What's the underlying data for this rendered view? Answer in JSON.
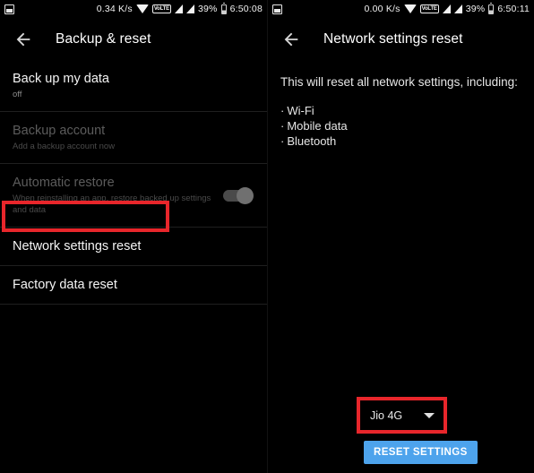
{
  "left_screen": {
    "status_bar": {
      "notification_icon": "screenshot-icon",
      "network_speed": "0.34 K/s",
      "wifi_icon": "wifi-icon",
      "volte_label": "VoLTE",
      "signal_icon": "signal-bars-icon",
      "battery_percent": "39%",
      "battery_icon": "battery-icon",
      "clock": "6:50:08"
    },
    "action_bar": {
      "back_icon": "back-arrow-icon",
      "title": "Backup & reset"
    },
    "items": [
      {
        "title": "Back up my data",
        "subtitle": "off",
        "disabled": false,
        "toggle": false
      },
      {
        "title": "Backup account",
        "subtitle": "Add a backup account now",
        "disabled": true,
        "toggle": false
      },
      {
        "title": "Automatic restore",
        "subtitle": "When reinstalling an app, restore backed up settings and data",
        "disabled": true,
        "toggle": true
      },
      {
        "title": "Network settings reset",
        "subtitle": "",
        "disabled": false,
        "toggle": false
      },
      {
        "title": "Factory data reset",
        "subtitle": "",
        "disabled": false,
        "toggle": false
      }
    ]
  },
  "right_screen": {
    "status_bar": {
      "notification_icon": "screenshot-icon",
      "network_speed": "0.00 K/s",
      "wifi_icon": "wifi-icon",
      "volte_label": "VoLTE",
      "signal_icon": "signal-bars-icon",
      "battery_percent": "39%",
      "battery_icon": "battery-icon",
      "clock": "6:50:11"
    },
    "action_bar": {
      "back_icon": "back-arrow-icon",
      "title": "Network settings reset"
    },
    "lead_text": "This will reset all network settings, including:",
    "bullets": [
      {
        "dot": "·",
        "label": "Wi-Fi"
      },
      {
        "dot": "·",
        "label": "Mobile data"
      },
      {
        "dot": "·",
        "label": "Bluetooth"
      }
    ],
    "sim_spinner": {
      "selected": "Jio 4G",
      "caret_icon": "chevron-down-icon"
    },
    "reset_button": "RESET SETTINGS"
  },
  "annotations": {
    "highlight_color": "#e8262b",
    "boxes": [
      {
        "name": "network-settings-reset-highlight"
      },
      {
        "name": "sim-spinner-highlight"
      }
    ]
  },
  "colors": {
    "background": "#000000",
    "accent_button": "#4da3ec",
    "divider": "#1f1f1f"
  }
}
